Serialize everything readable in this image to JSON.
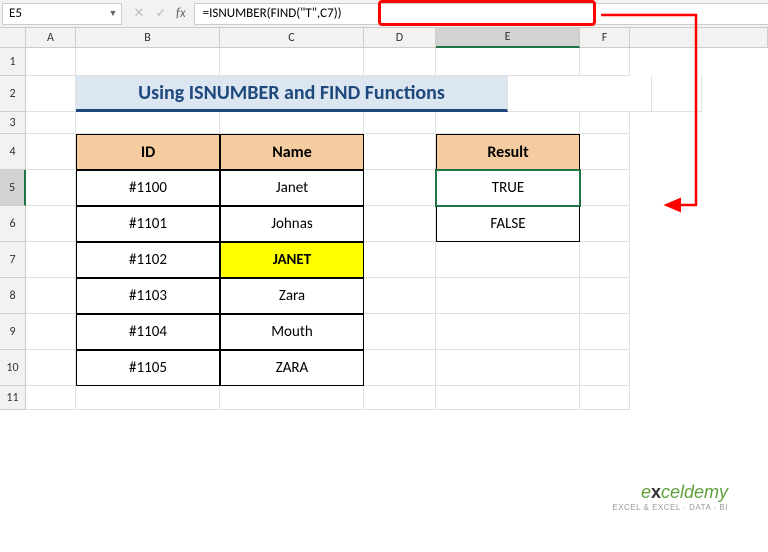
{
  "nameBox": "E5",
  "formula": "=ISNUMBER(FIND(\"T\",C7))",
  "columns": [
    "A",
    "B",
    "C",
    "D",
    "E",
    "F"
  ],
  "rowLabels": [
    "1",
    "2",
    "3",
    "4",
    "5",
    "6",
    "7",
    "8",
    "9",
    "10",
    "11"
  ],
  "title": "Using ISNUMBER and FIND Functions",
  "headers": {
    "id": "ID",
    "name": "Name",
    "result": "Result"
  },
  "rowsData": [
    {
      "id": "#1100",
      "name": "Janet"
    },
    {
      "id": "#1101",
      "name": "Johnas"
    },
    {
      "id": "#1102",
      "name": "JANET"
    },
    {
      "id": "#1103",
      "name": "Zara"
    },
    {
      "id": "#1104",
      "name": "Mouth"
    },
    {
      "id": "#1105",
      "name": "ZARA"
    }
  ],
  "results": [
    "TRUE",
    "FALSE"
  ],
  "watermark": {
    "main_pre": "e",
    "main_x": "x",
    "main_post": "celdemy",
    "sub": "EXCEL & EXCEL · DATA · BI"
  }
}
